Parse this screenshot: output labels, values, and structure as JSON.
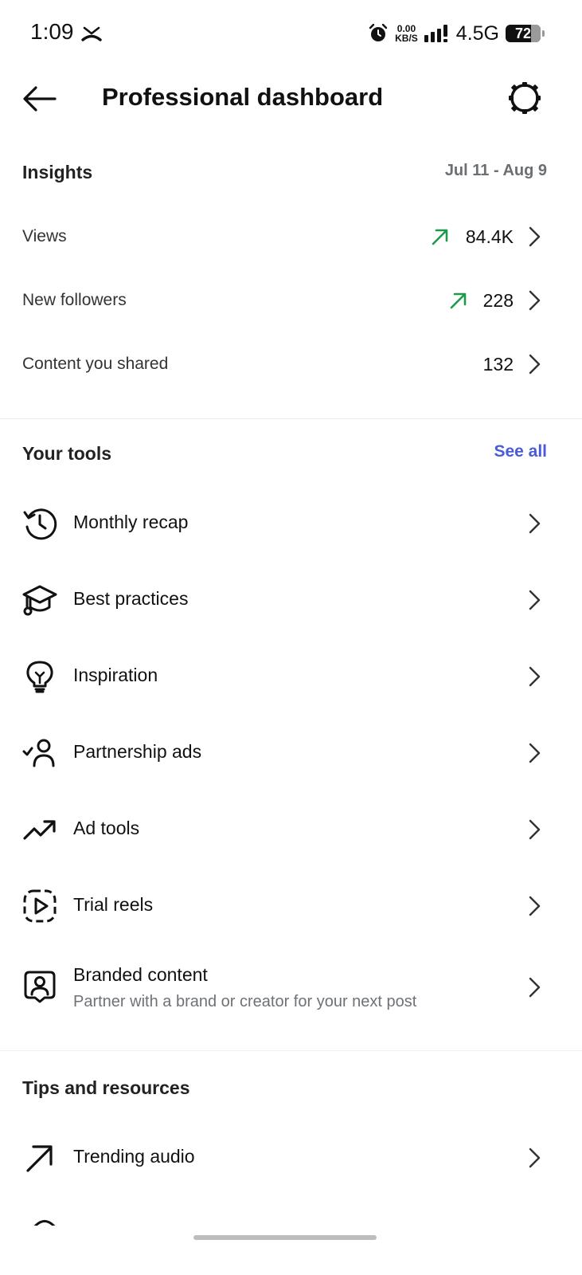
{
  "status_bar": {
    "time": "1:09",
    "net_speed_value": "0.00",
    "net_speed_unit": "KB/S",
    "network_type": "4.5G",
    "battery_level": "72",
    "battery_fraction": 0.72
  },
  "header": {
    "title": "Professional dashboard"
  },
  "insights": {
    "title": "Insights",
    "date_range": "Jul 11 - Aug 9",
    "metrics": [
      {
        "label": "Views",
        "value": "84.4K",
        "trend": "up"
      },
      {
        "label": "New followers",
        "value": "228",
        "trend": "up"
      },
      {
        "label": "Content you shared",
        "value": "132",
        "trend": ""
      }
    ]
  },
  "tools": {
    "title": "Your tools",
    "see_all": "See all",
    "items": [
      {
        "label": "Monthly recap",
        "icon": "history-icon"
      },
      {
        "label": "Best practices",
        "icon": "graduation-cap-icon"
      },
      {
        "label": "Inspiration",
        "icon": "lightbulb-icon"
      },
      {
        "label": "Partnership ads",
        "icon": "person-check-icon"
      },
      {
        "label": "Ad tools",
        "icon": "trending-up-icon"
      },
      {
        "label": "Trial reels",
        "icon": "dashed-play-icon"
      },
      {
        "label": "Branded content",
        "sublabel": "Partner with a brand or creator for your next post",
        "icon": "person-frame-icon"
      }
    ]
  },
  "tips": {
    "title": "Tips and resources",
    "items": [
      {
        "label": "Trending audio",
        "icon": "arrow-up-right-icon"
      }
    ]
  },
  "colors": {
    "trend_up": "#1f9a4c",
    "link": "#4a5bd6",
    "secondary_text": "#6e7277"
  }
}
